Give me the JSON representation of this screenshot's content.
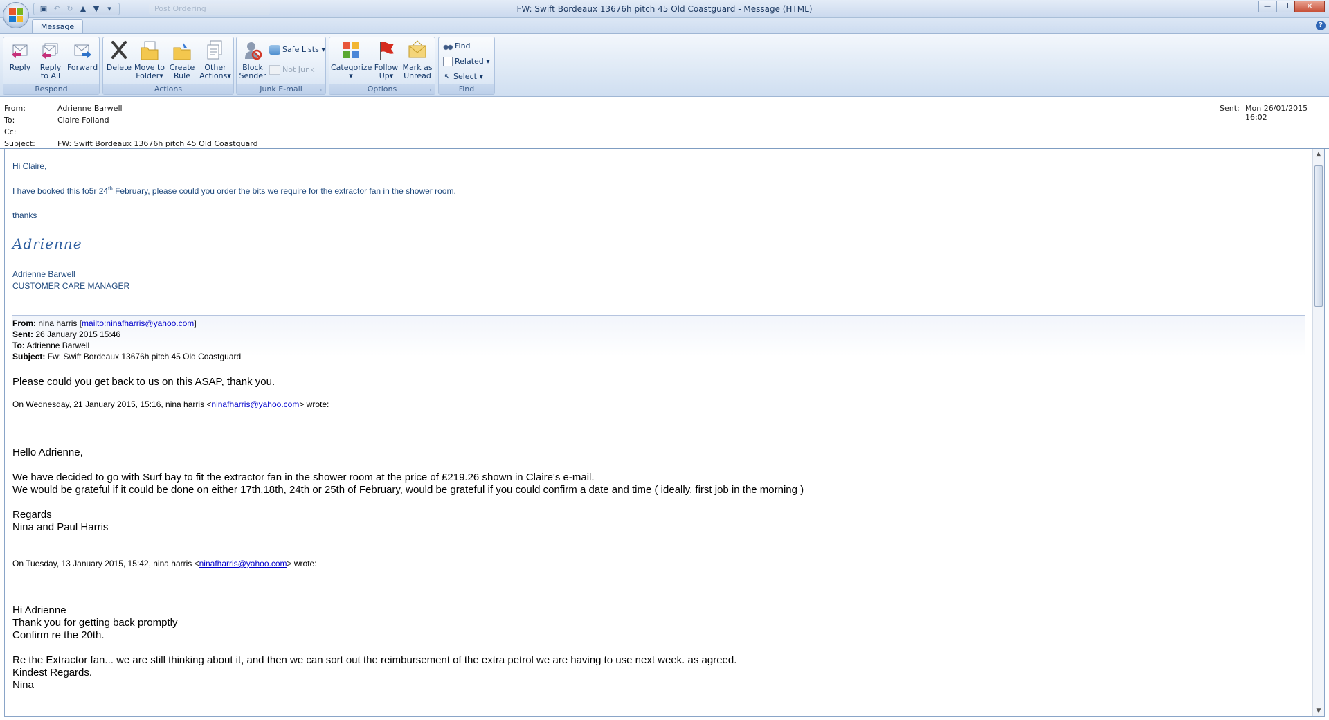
{
  "window": {
    "title": "FW: Swift Bordeaux 13676h pitch 45 Old Coastguard - Message (HTML)",
    "ghost_title": "Post Ordering",
    "controls": {
      "minimize": "—",
      "maximize": "❐",
      "close": "✕"
    }
  },
  "ribbon": {
    "tab": "Message",
    "groups": {
      "respond": {
        "label": "Respond",
        "reply": "Reply",
        "reply_all_1": "Reply",
        "reply_all_2": "to All",
        "forward": "Forward"
      },
      "actions": {
        "label": "Actions",
        "delete": "Delete",
        "move_1": "Move to",
        "move_2": "Folder",
        "rule_1": "Create",
        "rule_2": "Rule",
        "other_1": "Other",
        "other_2": "Actions"
      },
      "junk": {
        "label": "Junk E-mail",
        "block_1": "Block",
        "block_2": "Sender",
        "safe_lists": "Safe Lists",
        "not_junk": "Not Junk"
      },
      "options": {
        "label": "Options",
        "categorize": "Categorize",
        "follow_1": "Follow",
        "follow_2": "Up",
        "mark_1": "Mark as",
        "mark_2": "Unread"
      },
      "find": {
        "label": "Find",
        "find": "Find",
        "related": "Related",
        "select": "Select"
      }
    }
  },
  "header": {
    "from_label": "From:",
    "from": "Adrienne Barwell",
    "to_label": "To:",
    "to": "Claire Folland",
    "cc_label": "Cc:",
    "cc": "",
    "subject_label": "Subject:",
    "subject": "FW: Swift Bordeaux 13676h pitch 45 Old Coastguard",
    "sent_label": "Sent:",
    "sent": "Mon 26/01/2015 16:02"
  },
  "body": {
    "greeting": "Hi Claire,",
    "line1_a": "I have booked this fo5r 24",
    "line1_sup": "th",
    "line1_b": " February, please could you order the bits we require for the extractor fan in the shower room.",
    "thanks": "thanks",
    "signature_script": "Adrienne",
    "sig_name": "Adrienne Barwell",
    "sig_title": "CUSTOMER CARE MANAGER",
    "fwd": {
      "from_label": "From:",
      "from_name": "nina harris",
      "from_link": "mailto:ninafharris@yahoo.com",
      "sent_label": "Sent:",
      "sent": "26 January 2015 15:46",
      "to_label": "To:",
      "to": "Adrienne Barwell",
      "subject_label": "Subject:",
      "subject": "Fw: Swift Bordeaux 13676h pitch 45 Old Coastguard"
    },
    "p1": "Please could you get back to us on this ASAP, thank you.",
    "quote1_a": "On Wednesday, 21 January 2015, 15:16, nina harris <",
    "quote1_link": "ninafharris@yahoo.com",
    "quote1_b": "> wrote:",
    "hello": "Hello Adrienne,",
    "p2": "We have decided to go with Surf bay to fit the extractor fan in the shower room at the price of £219.26 shown in Claire's e-mail.",
    "p3": "We would be grateful if it could be done on either 17th,18th, 24th or 25th of February, would be grateful if you could confirm a date and time ( ideally, first job in the morning )",
    "regards": "Regards",
    "names": "Nina and Paul Harris",
    "quote2_a": "On Tuesday, 13 January 2015, 15:42, nina harris <",
    "quote2_link": "ninafharris@yahoo.com",
    "quote2_b": "> wrote:",
    "hi": "Hi Adrienne",
    "p4": "Thank you for getting back promptly",
    "p5": "Confirm re the 20th.",
    "p6": "Re the Extractor fan... we are still thinking about it, and then we can sort  out the reimbursement  of the  extra petrol we are having to use next week. as agreed.",
    "kindest": "Kindest Regards.",
    "nina": "Nina"
  }
}
